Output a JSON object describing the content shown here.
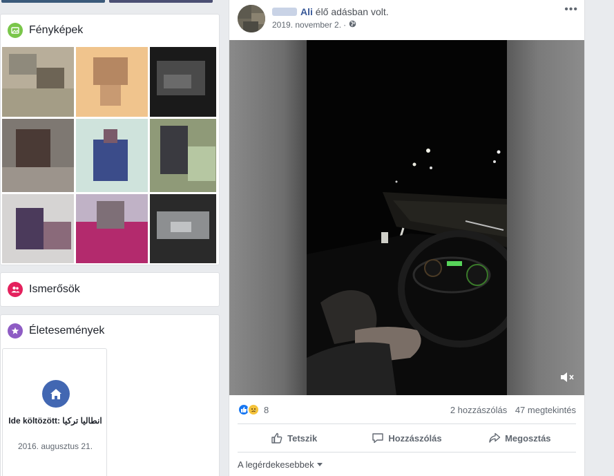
{
  "sidebar": {
    "photos": {
      "title": "Fényképek"
    },
    "friends": {
      "title": "Ismerősök"
    },
    "life_events": {
      "title": "Életesemények",
      "event": {
        "title": "Ide költözött: انطاليا تركيا",
        "date": "2016. augusztus 21."
      }
    }
  },
  "post": {
    "author": "Ali",
    "action_text": "élő adásban volt.",
    "date": "2019. november 2.",
    "separator": "·",
    "more": "•••",
    "reaction_count": "8",
    "comments": "2 hozzászólás",
    "views": "47 megtekintés",
    "actions": {
      "like": "Tetszik",
      "comment": "Hozzászólás",
      "share": "Megosztás"
    },
    "sort_label": "A legérdekesebbek"
  },
  "colors": {
    "brand": "#4267b2",
    "link": "#385898",
    "photos_icon": "#7ac64a",
    "friends_icon": "#e4215d",
    "events_icon": "#8e5cc4"
  }
}
